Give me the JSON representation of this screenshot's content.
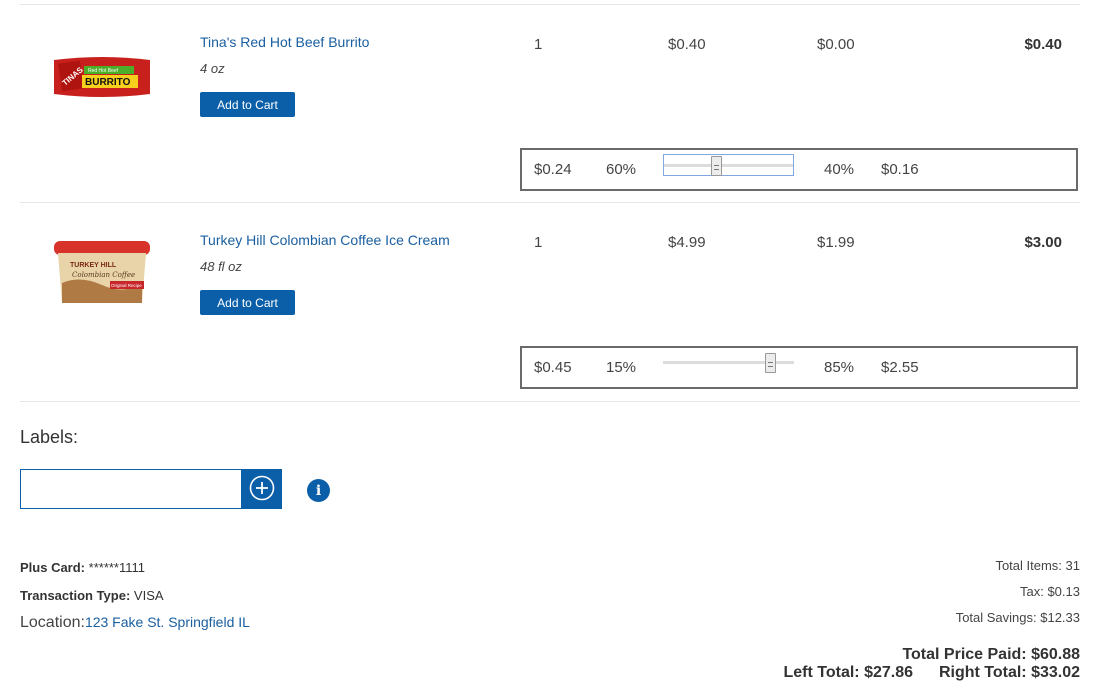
{
  "items": [
    {
      "name": "Tina's Red Hot Beef Burrito",
      "size": "4 oz",
      "add_label": "Add to Cart",
      "qty": "1",
      "price": "$0.40",
      "discount": "$0.00",
      "total": "$0.40",
      "image": {
        "brand": "TINAS",
        "top": "Red Hot Beef",
        "label": "BURRITO"
      },
      "split": {
        "left_amount": "$0.24",
        "left_pct": "60%",
        "right_pct": "40%",
        "right_amount": "$0.16",
        "value": 0.4
      }
    },
    {
      "name": "Turkey Hill Colombian Coffee Ice Cream",
      "size": "48 fl oz",
      "add_label": "Add to Cart",
      "qty": "1",
      "price": "$4.99",
      "discount": "$1.99",
      "total": "$3.00",
      "image": {
        "brand": "TURKEY HILL",
        "flavor": "Colombian Coffee",
        "badge": "Original Recipe"
      },
      "split": {
        "left_amount": "$0.45",
        "left_pct": "15%",
        "right_pct": "85%",
        "right_amount": "$2.55",
        "value": 0.85
      }
    }
  ],
  "labels": {
    "title": "Labels:",
    "input_value": "",
    "input_placeholder": ""
  },
  "receipt": {
    "plus_card_label": "Plus Card:",
    "plus_card_value": "******1111",
    "transaction_label": "Transaction Type:",
    "transaction_value": "VISA",
    "location_label": "Location:",
    "location_value": "123 Fake St. Springfield IL"
  },
  "summary": {
    "total_items": "Total Items: 31",
    "tax": "Tax: $0.13",
    "savings": "Total Savings: $12.33",
    "total_paid": "Total Price Paid: $60.88",
    "left_total": "Left Total: $27.86",
    "right_total": "Right Total: $33.02"
  },
  "colors": {
    "primary": "#0a5fa8",
    "link": "#1a5fa0"
  },
  "icons": {
    "add_label": "plus-circle-icon",
    "info": "info-icon"
  }
}
